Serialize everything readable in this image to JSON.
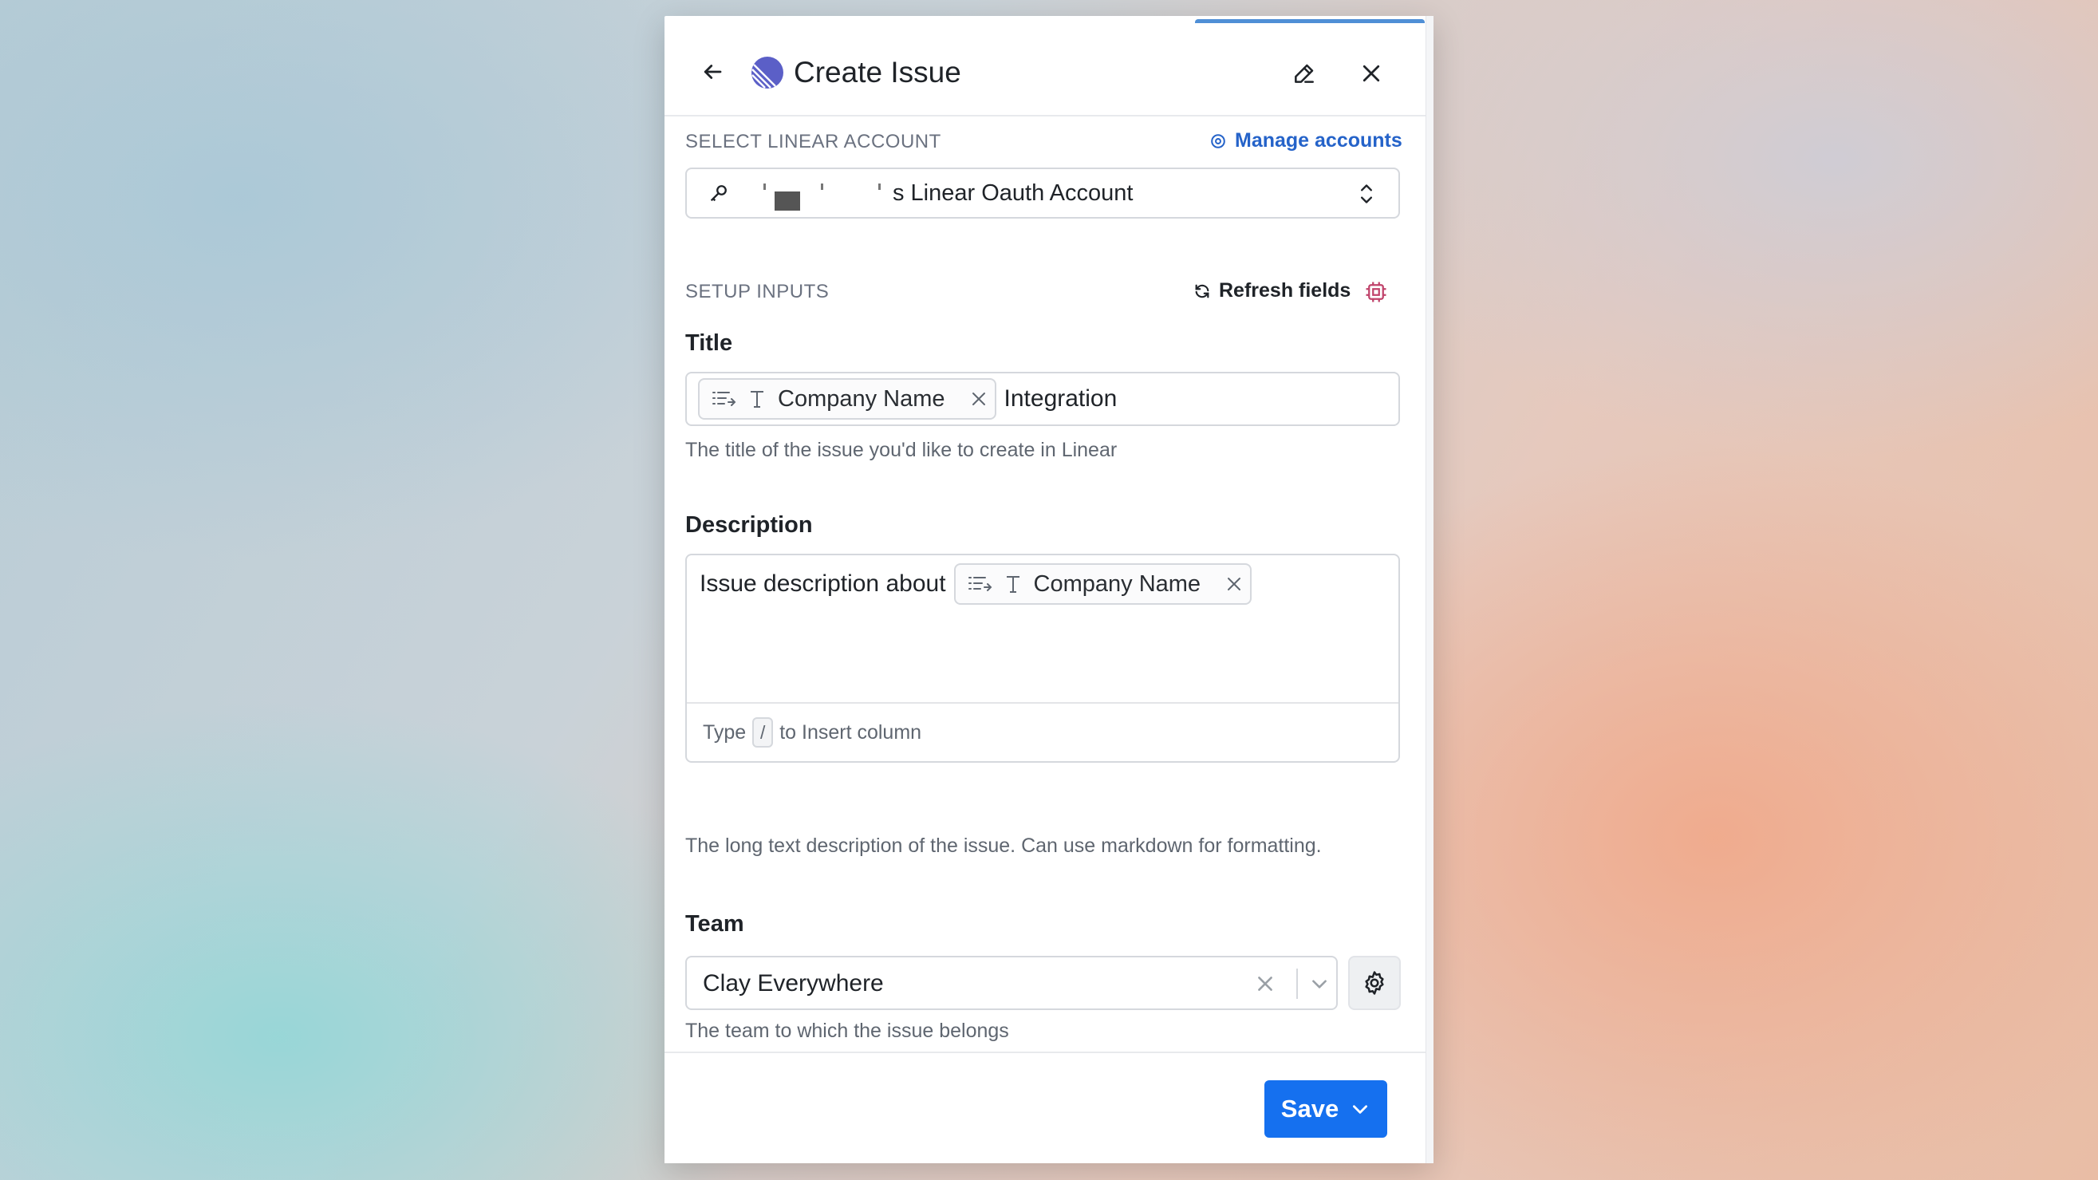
{
  "panel": {
    "title": "Create Issue"
  },
  "account": {
    "section_label": "SELECT LINEAR ACCOUNT",
    "manage_label": "Manage accounts",
    "selected_value": "s Linear Oauth Account"
  },
  "setup": {
    "section_label": "SETUP INPUTS",
    "refresh_label": "Refresh fields"
  },
  "title_field": {
    "label": "Title",
    "chip_label": "Company Name",
    "after_text": "Integration",
    "help": "The title of the issue you'd like to create in Linear"
  },
  "description_field": {
    "label": "Description",
    "text_before": "Issue description about",
    "chip_label": "Company Name",
    "footer_prefix": "Type",
    "footer_key": "/",
    "footer_suffix": "to Insert column",
    "help": "The long text description of the issue. Can use markdown for formatting."
  },
  "team_field": {
    "label": "Team",
    "value": "Clay Everywhere",
    "help": "The team to which the issue belongs"
  },
  "footer": {
    "save_label": "Save"
  },
  "icons": {
    "back": "arrow-left-icon",
    "logo": "linear-logo",
    "edit": "pencil-icon",
    "close": "close-icon",
    "manage": "gear-icon",
    "key": "key-icon",
    "updown": "chevron-updown-icon",
    "refresh": "refresh-icon",
    "chip": "cpu-icon",
    "column": "column-ref-icon",
    "text_type": "text-type-icon",
    "remove": "close-icon",
    "caret": "chevron-down-icon"
  },
  "colors": {
    "accent": "#1570ef",
    "link": "#2563c9",
    "chip_icon": "#c0436b",
    "logo": "#5b5fc7"
  }
}
